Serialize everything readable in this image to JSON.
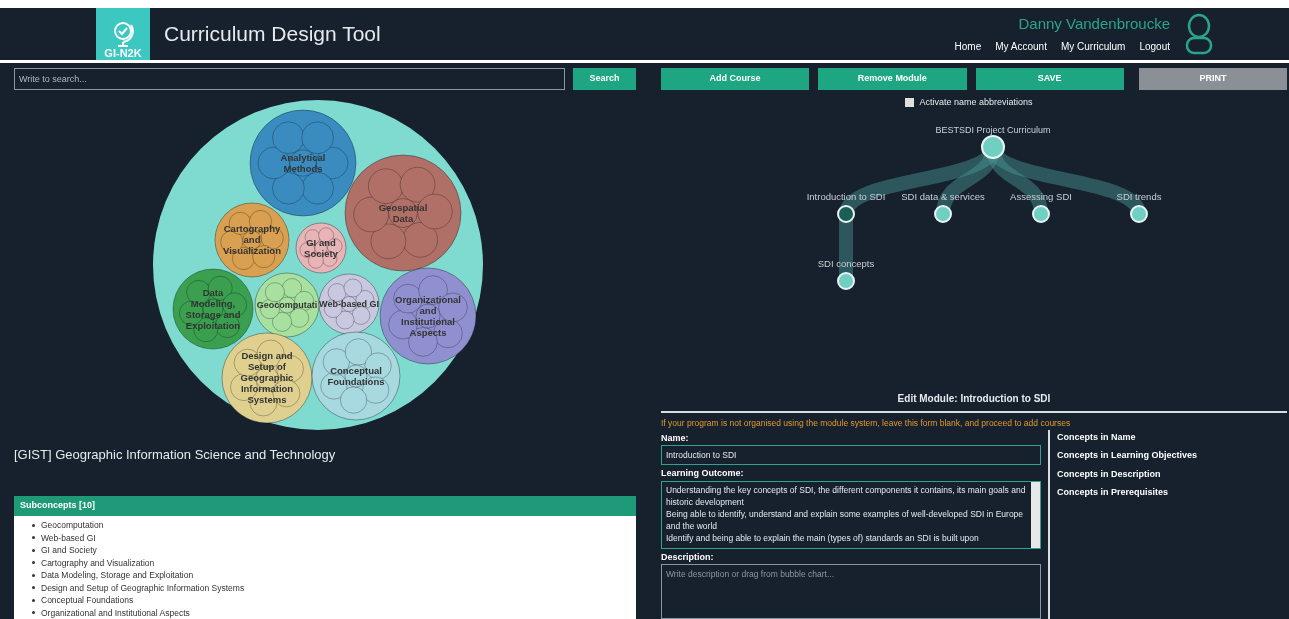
{
  "header": {
    "logo_text": "GI-N2K",
    "title": "Curriculum Design Tool",
    "user_name": "Danny Vandenbroucke",
    "nav": [
      "Home",
      "My Account",
      "My Curriculum",
      "Logout"
    ]
  },
  "search": {
    "placeholder": "Write to search...",
    "button": "Search"
  },
  "bubble_chart": {
    "bubbles": [
      {
        "lines": [
          "Analytical",
          "Methods"
        ],
        "color": "#3a8cc0"
      },
      {
        "lines": [
          "Geospatial",
          "Data"
        ],
        "color": "#b07068"
      },
      {
        "lines": [
          "Cartography",
          "and",
          "Visualization"
        ],
        "color": "#d8a050"
      },
      {
        "lines": [
          "GI and",
          "Society"
        ],
        "color": "#e8b4b8"
      },
      {
        "lines": [
          "Data",
          "Modeling,",
          "Storage and",
          "Exploitation"
        ],
        "color": "#3aa050"
      },
      {
        "lines": [
          "Geocomputati"
        ],
        "color": "#a8e0a0"
      },
      {
        "lines": [
          "Web-based GI"
        ],
        "color": "#c8c8e0"
      },
      {
        "lines": [
          "Organizational",
          "and",
          "Institutional",
          "Aspects"
        ],
        "color": "#9090d0"
      },
      {
        "lines": [
          "Design and",
          "Setup of",
          "Geographic",
          "Information",
          "Systems"
        ],
        "color": "#e0d090"
      },
      {
        "lines": [
          "Conceptual",
          "Foundations"
        ],
        "color": "#a8d8e0"
      }
    ]
  },
  "concept_title": "[GIST] Geographic Information Science and Technology",
  "subconcepts": {
    "title": "Subconcepts [10]",
    "items": [
      "Geocomputation",
      "Web-based GI",
      "GI and Society",
      "Cartography and Visualization",
      "Data Modeling, Storage and Exploitation",
      "Design and Setup of Geographic Information Systems",
      "Conceptual Foundations",
      "Organizational and Institutional Aspects"
    ]
  },
  "actions": [
    {
      "label": "Add Course",
      "disabled": false
    },
    {
      "label": "Remove Module",
      "disabled": false
    },
    {
      "label": "SAVE",
      "disabled": false
    },
    {
      "label": "PRINT",
      "disabled": true
    }
  ],
  "abbreviations": {
    "label": "Activate name abbreviations",
    "checked": false
  },
  "tree": {
    "label": "BESTSDI Project Curriculum",
    "selected": false,
    "children": [
      {
        "label": "Introduction to SDI",
        "selected": true,
        "children": [
          {
            "label": "SDI concepts",
            "selected": false
          }
        ]
      },
      {
        "label": "SDI data & services",
        "selected": false
      },
      {
        "label": "Assessing SDI",
        "selected": false
      },
      {
        "label": "SDI trends",
        "selected": false
      }
    ]
  },
  "edit_module": {
    "title": "Edit Module: Introduction to SDI",
    "note": "If your program is not organised using the module system, leave this form blank, and proceed to add courses",
    "name_label": "Name:",
    "name_value": "Introduction to SDI",
    "outcome_label": "Learning Outcome:",
    "outcome_lines": [
      "Understanding the key concepts of SDI, the different components it contains, its main goals and historic development",
      "Being able to identify, understand and explain some examples of well-developed SDI in Europe and the world",
      "Identify and being able to explain the main (types of) standards an SDI is built upon"
    ],
    "description_label": "Description:",
    "description_placeholder": "Write description or drag from bubble chart...",
    "concept_headings": [
      "Concepts in Name",
      "Concepts in Learning Objectives",
      "Concepts in Description",
      "Concepts in Prerequisites"
    ]
  }
}
